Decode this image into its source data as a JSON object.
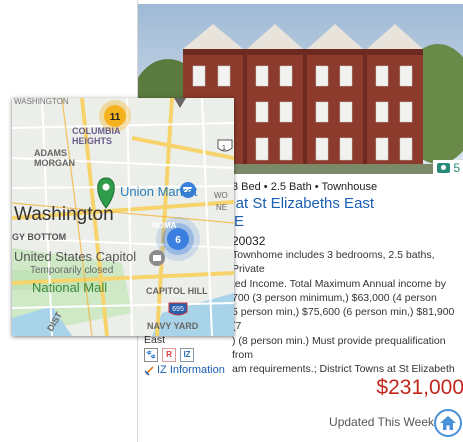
{
  "listing": {
    "photo_count": "5",
    "specs": "3 Bed • 2.5 Bath • Townhouse",
    "title_line1": "s at St Elizabeths East",
    "title_line2": "SE",
    "zip": "20032",
    "description_lines": [
      "Townhome includes 3 bedrooms, 2.5 baths, Private",
      "ted Income. Total Maximum Annual income by",
      "700 (3 person minimum,) $63,000 (4 person",
      "5 person min,) $75,600 (6 person min,) $81,900 (7",
      ") (8 person min.) Must provide prequalification from",
      "am requirements.; District Towns at St Elizabeth"
    ],
    "description_tail": "East",
    "iz_link": "IZ Information",
    "price": "$231,000",
    "updated": "Updated This Week"
  },
  "map": {
    "labels": {
      "washington_top": "WASHINGTON",
      "columbia_heights": "COLUMBIA\nHEIGHTS",
      "adams_morgan": "ADAMS\nMORGAN",
      "washington": "Washington",
      "union_market": "Union Market",
      "noma": "NOMA",
      "wo": "WO",
      "ne": "NE",
      "foggy_bottom": "GY BOTTOM",
      "capitol": "United States Capitol",
      "temporarily_closed": "Temporarily closed",
      "national_mall": "National Mall",
      "capitol_hill": "CAPITOL HILL",
      "navy_yard": "NAVY YARD",
      "dist": "DIST",
      "route_1": "1",
      "route_695": "695"
    },
    "clusters": [
      {
        "count": "11"
      },
      {
        "count": "6"
      }
    ]
  },
  "colors": {
    "link": "#1a5fb4",
    "price": "#c0281c",
    "cluster_orange": "#f5b21f",
    "cluster_blue": "#3b7fe0",
    "pin": "#2f9d4c"
  }
}
